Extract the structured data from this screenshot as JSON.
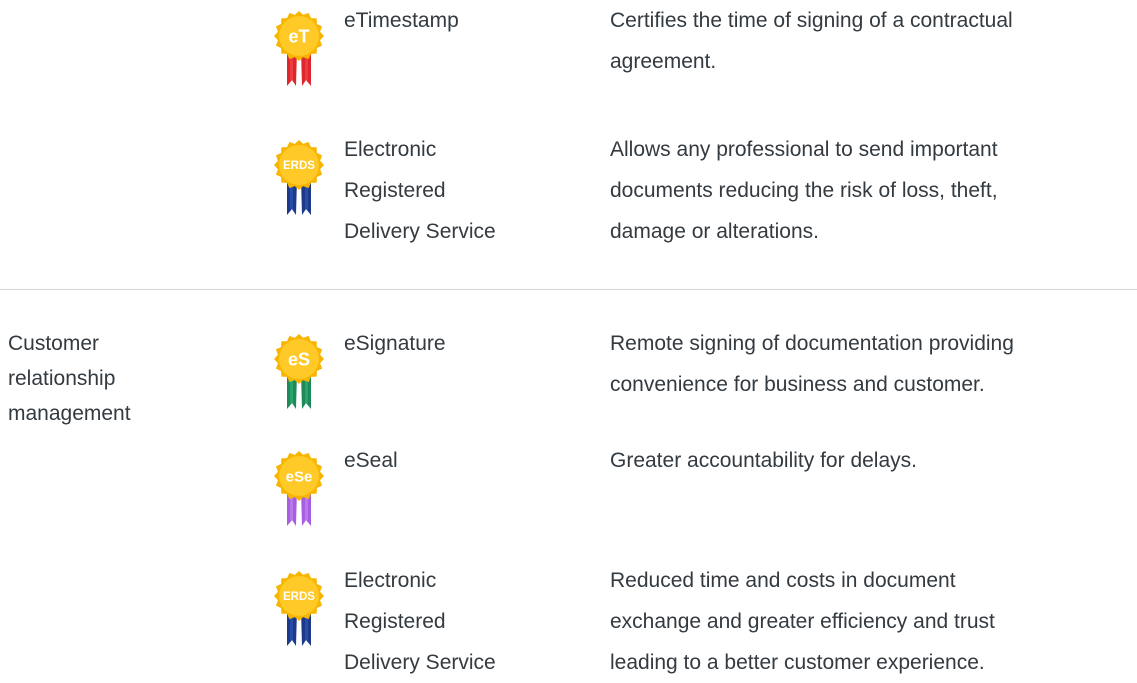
{
  "sections": [
    {
      "category": "",
      "rows": [
        {
          "badge": {
            "text": "eT",
            "ribbon": "#e0262d",
            "ribbon_light": "#f04848"
          },
          "service": "eTimestamp",
          "description": "Certifies the time of signing of a contractual\nagreement."
        },
        {
          "badge": {
            "text": "ERDS",
            "ribbon": "#1d3a8a",
            "ribbon_light": "#2c55b5"
          },
          "service": "Electronic\nRegistered\nDelivery Service",
          "description": "Allows any professional to send important\ndocuments reducing the risk of loss, theft,\ndamage or alterations."
        }
      ]
    },
    {
      "category": "Customer\nrelationship\nmanagement",
      "rows": [
        {
          "badge": {
            "text": "eS",
            "ribbon": "#1e8a5a",
            "ribbon_light": "#2fae73"
          },
          "service": "eSignature",
          "description": "Remote signing of documentation providing\nconvenience for business and customer."
        },
        {
          "badge": {
            "text": "eSe",
            "ribbon": "#a75ee0",
            "ribbon_light": "#c383f0"
          },
          "service": "eSeal",
          "description": "Greater accountability for delays."
        },
        {
          "badge": {
            "text": "ERDS",
            "ribbon": "#1d3a8a",
            "ribbon_light": "#2c55b5"
          },
          "service": "Electronic\nRegistered\nDelivery Service",
          "description": "Reduced time and costs in document\nexchange and greater efficiency and trust\nleading to a better customer experience."
        }
      ]
    }
  ],
  "colors": {
    "badge_gold": "#f7b500",
    "badge_gold_light": "#ffc928",
    "text": "#333a40",
    "divider": "#d6d6d6"
  }
}
